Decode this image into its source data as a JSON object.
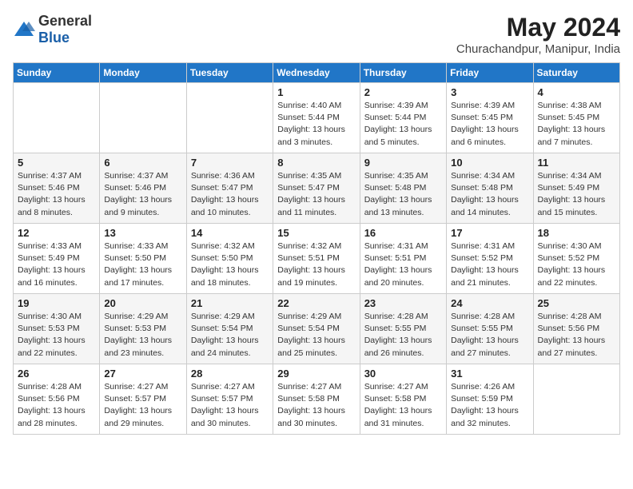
{
  "header": {
    "logo": {
      "general": "General",
      "blue": "Blue"
    },
    "month": "May 2024",
    "location": "Churachandpur, Manipur, India"
  },
  "weekdays": [
    "Sunday",
    "Monday",
    "Tuesday",
    "Wednesday",
    "Thursday",
    "Friday",
    "Saturday"
  ],
  "weeks": [
    [
      {
        "day": "",
        "sunrise": "",
        "sunset": "",
        "daylight": ""
      },
      {
        "day": "",
        "sunrise": "",
        "sunset": "",
        "daylight": ""
      },
      {
        "day": "",
        "sunrise": "",
        "sunset": "",
        "daylight": ""
      },
      {
        "day": "1",
        "sunrise": "Sunrise: 4:40 AM",
        "sunset": "Sunset: 5:44 PM",
        "daylight": "Daylight: 13 hours and 3 minutes."
      },
      {
        "day": "2",
        "sunrise": "Sunrise: 4:39 AM",
        "sunset": "Sunset: 5:44 PM",
        "daylight": "Daylight: 13 hours and 5 minutes."
      },
      {
        "day": "3",
        "sunrise": "Sunrise: 4:39 AM",
        "sunset": "Sunset: 5:45 PM",
        "daylight": "Daylight: 13 hours and 6 minutes."
      },
      {
        "day": "4",
        "sunrise": "Sunrise: 4:38 AM",
        "sunset": "Sunset: 5:45 PM",
        "daylight": "Daylight: 13 hours and 7 minutes."
      }
    ],
    [
      {
        "day": "5",
        "sunrise": "Sunrise: 4:37 AM",
        "sunset": "Sunset: 5:46 PM",
        "daylight": "Daylight: 13 hours and 8 minutes."
      },
      {
        "day": "6",
        "sunrise": "Sunrise: 4:37 AM",
        "sunset": "Sunset: 5:46 PM",
        "daylight": "Daylight: 13 hours and 9 minutes."
      },
      {
        "day": "7",
        "sunrise": "Sunrise: 4:36 AM",
        "sunset": "Sunset: 5:47 PM",
        "daylight": "Daylight: 13 hours and 10 minutes."
      },
      {
        "day": "8",
        "sunrise": "Sunrise: 4:35 AM",
        "sunset": "Sunset: 5:47 PM",
        "daylight": "Daylight: 13 hours and 11 minutes."
      },
      {
        "day": "9",
        "sunrise": "Sunrise: 4:35 AM",
        "sunset": "Sunset: 5:48 PM",
        "daylight": "Daylight: 13 hours and 13 minutes."
      },
      {
        "day": "10",
        "sunrise": "Sunrise: 4:34 AM",
        "sunset": "Sunset: 5:48 PM",
        "daylight": "Daylight: 13 hours and 14 minutes."
      },
      {
        "day": "11",
        "sunrise": "Sunrise: 4:34 AM",
        "sunset": "Sunset: 5:49 PM",
        "daylight": "Daylight: 13 hours and 15 minutes."
      }
    ],
    [
      {
        "day": "12",
        "sunrise": "Sunrise: 4:33 AM",
        "sunset": "Sunset: 5:49 PM",
        "daylight": "Daylight: 13 hours and 16 minutes."
      },
      {
        "day": "13",
        "sunrise": "Sunrise: 4:33 AM",
        "sunset": "Sunset: 5:50 PM",
        "daylight": "Daylight: 13 hours and 17 minutes."
      },
      {
        "day": "14",
        "sunrise": "Sunrise: 4:32 AM",
        "sunset": "Sunset: 5:50 PM",
        "daylight": "Daylight: 13 hours and 18 minutes."
      },
      {
        "day": "15",
        "sunrise": "Sunrise: 4:32 AM",
        "sunset": "Sunset: 5:51 PM",
        "daylight": "Daylight: 13 hours and 19 minutes."
      },
      {
        "day": "16",
        "sunrise": "Sunrise: 4:31 AM",
        "sunset": "Sunset: 5:51 PM",
        "daylight": "Daylight: 13 hours and 20 minutes."
      },
      {
        "day": "17",
        "sunrise": "Sunrise: 4:31 AM",
        "sunset": "Sunset: 5:52 PM",
        "daylight": "Daylight: 13 hours and 21 minutes."
      },
      {
        "day": "18",
        "sunrise": "Sunrise: 4:30 AM",
        "sunset": "Sunset: 5:52 PM",
        "daylight": "Daylight: 13 hours and 22 minutes."
      }
    ],
    [
      {
        "day": "19",
        "sunrise": "Sunrise: 4:30 AM",
        "sunset": "Sunset: 5:53 PM",
        "daylight": "Daylight: 13 hours and 22 minutes."
      },
      {
        "day": "20",
        "sunrise": "Sunrise: 4:29 AM",
        "sunset": "Sunset: 5:53 PM",
        "daylight": "Daylight: 13 hours and 23 minutes."
      },
      {
        "day": "21",
        "sunrise": "Sunrise: 4:29 AM",
        "sunset": "Sunset: 5:54 PM",
        "daylight": "Daylight: 13 hours and 24 minutes."
      },
      {
        "day": "22",
        "sunrise": "Sunrise: 4:29 AM",
        "sunset": "Sunset: 5:54 PM",
        "daylight": "Daylight: 13 hours and 25 minutes."
      },
      {
        "day": "23",
        "sunrise": "Sunrise: 4:28 AM",
        "sunset": "Sunset: 5:55 PM",
        "daylight": "Daylight: 13 hours and 26 minutes."
      },
      {
        "day": "24",
        "sunrise": "Sunrise: 4:28 AM",
        "sunset": "Sunset: 5:55 PM",
        "daylight": "Daylight: 13 hours and 27 minutes."
      },
      {
        "day": "25",
        "sunrise": "Sunrise: 4:28 AM",
        "sunset": "Sunset: 5:56 PM",
        "daylight": "Daylight: 13 hours and 27 minutes."
      }
    ],
    [
      {
        "day": "26",
        "sunrise": "Sunrise: 4:28 AM",
        "sunset": "Sunset: 5:56 PM",
        "daylight": "Daylight: 13 hours and 28 minutes."
      },
      {
        "day": "27",
        "sunrise": "Sunrise: 4:27 AM",
        "sunset": "Sunset: 5:57 PM",
        "daylight": "Daylight: 13 hours and 29 minutes."
      },
      {
        "day": "28",
        "sunrise": "Sunrise: 4:27 AM",
        "sunset": "Sunset: 5:57 PM",
        "daylight": "Daylight: 13 hours and 30 minutes."
      },
      {
        "day": "29",
        "sunrise": "Sunrise: 4:27 AM",
        "sunset": "Sunset: 5:58 PM",
        "daylight": "Daylight: 13 hours and 30 minutes."
      },
      {
        "day": "30",
        "sunrise": "Sunrise: 4:27 AM",
        "sunset": "Sunset: 5:58 PM",
        "daylight": "Daylight: 13 hours and 31 minutes."
      },
      {
        "day": "31",
        "sunrise": "Sunrise: 4:26 AM",
        "sunset": "Sunset: 5:59 PM",
        "daylight": "Daylight: 13 hours and 32 minutes."
      },
      {
        "day": "",
        "sunrise": "",
        "sunset": "",
        "daylight": ""
      }
    ]
  ]
}
